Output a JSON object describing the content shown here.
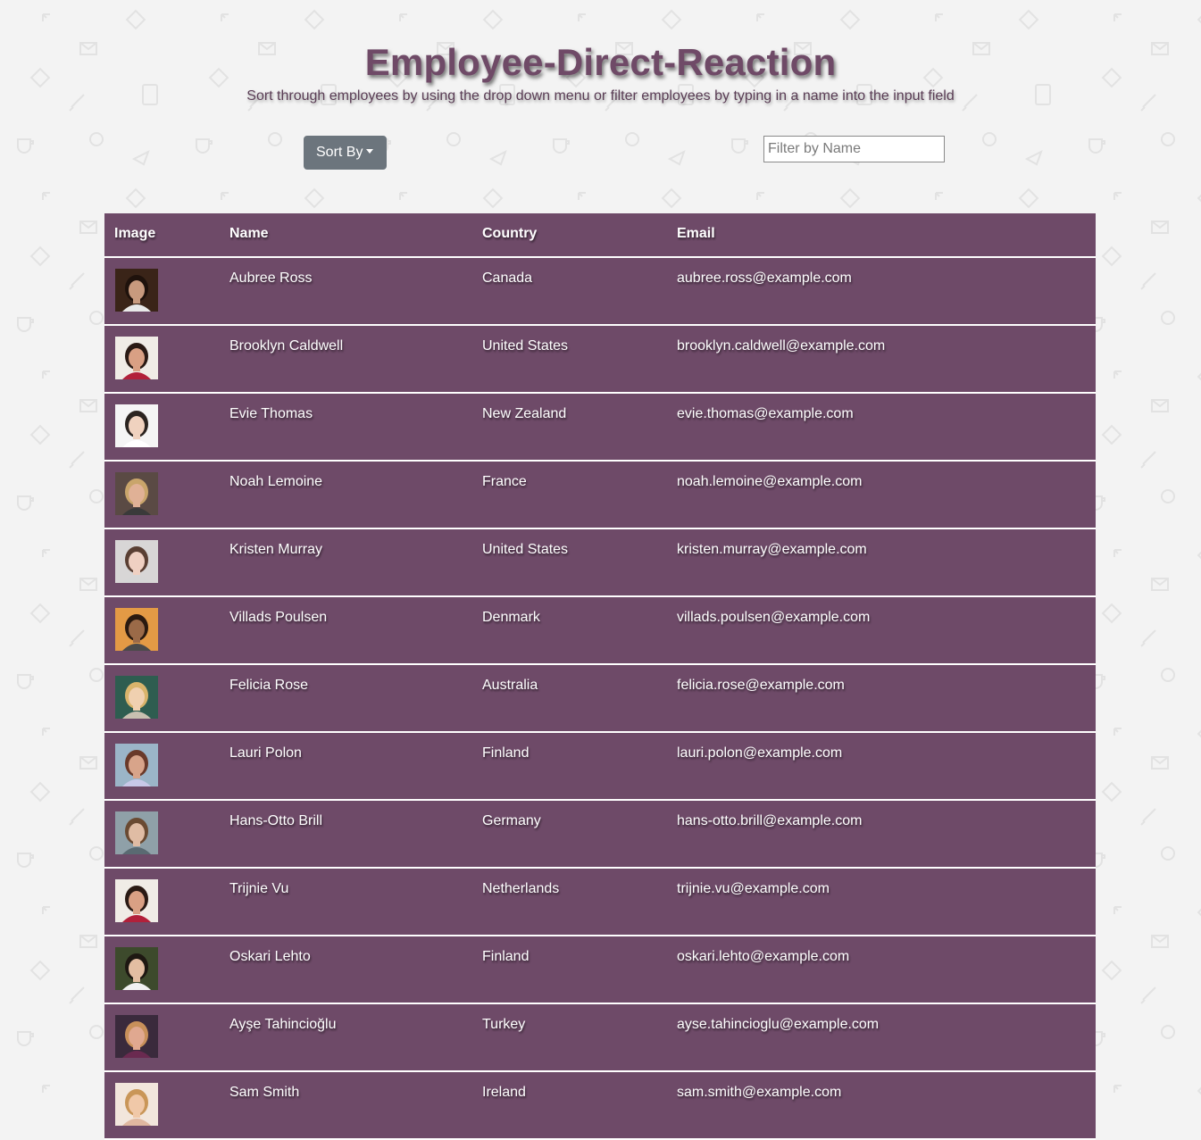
{
  "header": {
    "title": "Employee-Direct-Reaction",
    "subtitle": "Sort through employees by using the drop down menu or filter employees by typing in a name into the input field"
  },
  "controls": {
    "sort_label": "Sort By",
    "filter_placeholder": "Filter by Name"
  },
  "table": {
    "columns": [
      "Image",
      "Name",
      "Country",
      "Email"
    ],
    "rows": [
      {
        "name": "Aubree Ross",
        "country": "Canada",
        "email": "aubree.ross@example.com"
      },
      {
        "name": "Brooklyn Caldwell",
        "country": "United States",
        "email": "brooklyn.caldwell@example.com"
      },
      {
        "name": "Evie Thomas",
        "country": "New Zealand",
        "email": "evie.thomas@example.com"
      },
      {
        "name": "Noah Lemoine",
        "country": "France",
        "email": "noah.lemoine@example.com"
      },
      {
        "name": "Kristen Murray",
        "country": "United States",
        "email": "kristen.murray@example.com"
      },
      {
        "name": "Villads Poulsen",
        "country": "Denmark",
        "email": "villads.poulsen@example.com"
      },
      {
        "name": "Felicia Rose",
        "country": "Australia",
        "email": "felicia.rose@example.com"
      },
      {
        "name": "Lauri Polon",
        "country": "Finland",
        "email": "lauri.polon@example.com"
      },
      {
        "name": "Hans-Otto Brill",
        "country": "Germany",
        "email": "hans-otto.brill@example.com"
      },
      {
        "name": "Trijnie Vu",
        "country": "Netherlands",
        "email": "trijnie.vu@example.com"
      },
      {
        "name": "Oskari Lehto",
        "country": "Finland",
        "email": "oskari.lehto@example.com"
      },
      {
        "name": "Ayşe Tahincioğlu",
        "country": "Turkey",
        "email": "ayse.tahincioglu@example.com"
      },
      {
        "name": "Sam Smith",
        "country": "Ireland",
        "email": "sam.smith@example.com"
      }
    ]
  },
  "colors": {
    "table_background": "#6e4a68",
    "title_color": "#6f4a67",
    "sort_button_background": "#6c757d",
    "page_background": "#f3f3f3"
  }
}
